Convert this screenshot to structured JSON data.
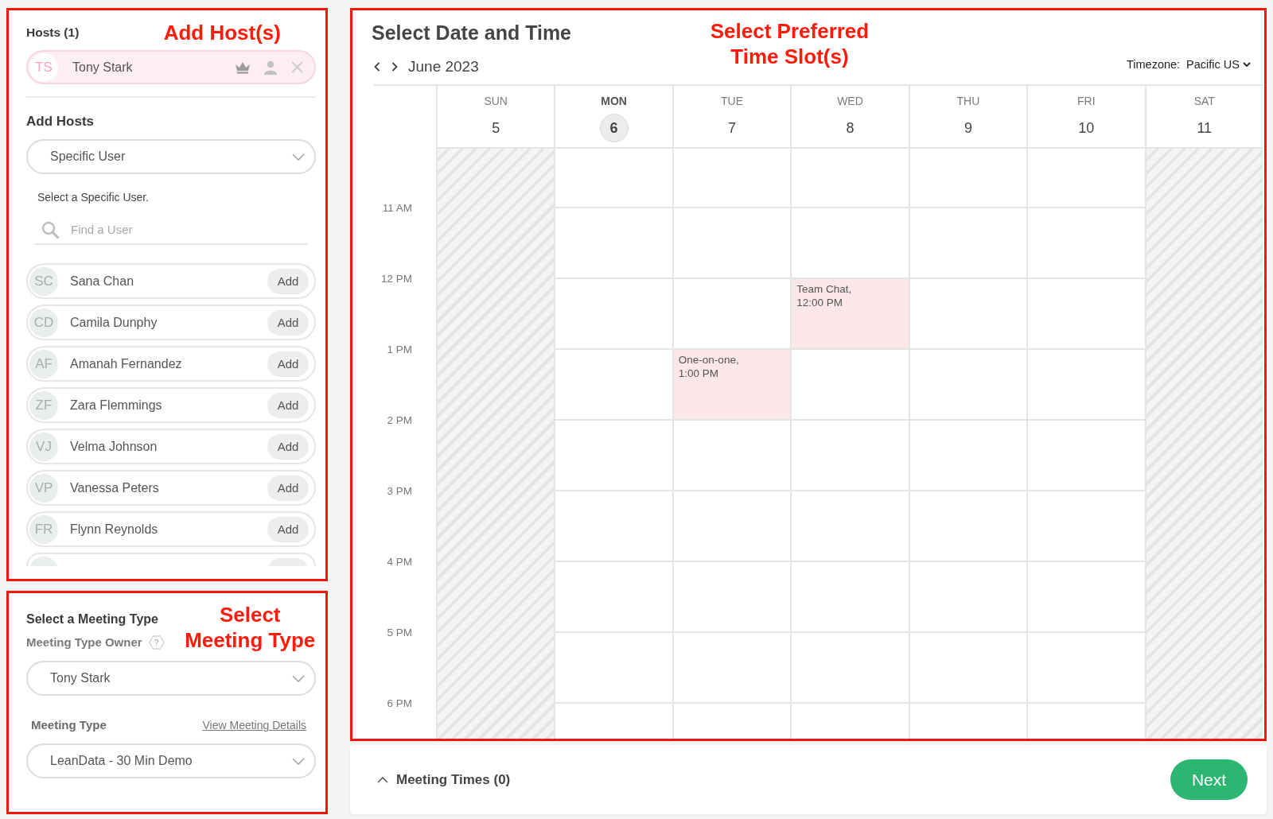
{
  "hosts_panel": {
    "annotation": "Add Host(s)",
    "title": "Hosts (1)",
    "hosts": [
      {
        "initials": "TS",
        "name": "Tony Stark"
      }
    ],
    "add_title": "Add Hosts",
    "host_source": {
      "value": "Specific User"
    },
    "hint": "Select a Specific User.",
    "search": {
      "placeholder": "Find a User"
    },
    "users": [
      {
        "initials": "SC",
        "name": "Sana Chan",
        "action": "Add"
      },
      {
        "initials": "CD",
        "name": "Camila Dunphy",
        "action": "Add"
      },
      {
        "initials": "AF",
        "name": "Amanah Fernandez",
        "action": "Add"
      },
      {
        "initials": "ZF",
        "name": "Zara Flemmings",
        "action": "Add"
      },
      {
        "initials": "VJ",
        "name": "Velma Johnson",
        "action": "Add"
      },
      {
        "initials": "VP",
        "name": "Vanessa Peters",
        "action": "Add"
      },
      {
        "initials": "FR",
        "name": "Flynn Reynolds",
        "action": "Add"
      }
    ],
    "more_below": true
  },
  "meeting_panel": {
    "title": "Select a Meeting Type",
    "annotation": "Select\nMeeting Type",
    "owner_label": "Meeting Type Owner",
    "owner_help": "?",
    "owner": {
      "value": "Tony Stark"
    },
    "type_label": "Meeting Type",
    "details_link": "View Meeting Details",
    "meeting_type": {
      "value": "LeanData - 30 Min Demo"
    }
  },
  "calendar": {
    "title": "Select Date and Time",
    "annotation": "Select Preferred\nTime Slot(s)",
    "month": "June 2023",
    "timezone": {
      "label": "Timezone:",
      "value": "Pacific US"
    },
    "days": [
      {
        "name": "SUN",
        "date": "5",
        "today": false,
        "unavailable": true
      },
      {
        "name": "MON",
        "date": "6",
        "today": true,
        "unavailable": false
      },
      {
        "name": "TUE",
        "date": "7",
        "today": false,
        "unavailable": false,
        "events": [
          {
            "title": "One-on-one,",
            "time": "1:00 PM"
          }
        ]
      },
      {
        "name": "WED",
        "date": "8",
        "today": false,
        "unavailable": false,
        "events": [
          {
            "title": "Team Chat,",
            "time": "12:00 PM"
          }
        ]
      },
      {
        "name": "THU",
        "date": "9",
        "today": false,
        "unavailable": false
      },
      {
        "name": "FRI",
        "date": "10",
        "today": false,
        "unavailable": false
      },
      {
        "name": "SAT",
        "date": "11",
        "today": false,
        "unavailable": true
      }
    ],
    "hours": [
      "11 AM",
      "12 PM",
      "1 PM",
      "2 PM",
      "3 PM",
      "4 PM",
      "5 PM",
      "6 PM"
    ]
  },
  "footer": {
    "meeting_times": "Meeting Times (0)",
    "next": "Next"
  }
}
